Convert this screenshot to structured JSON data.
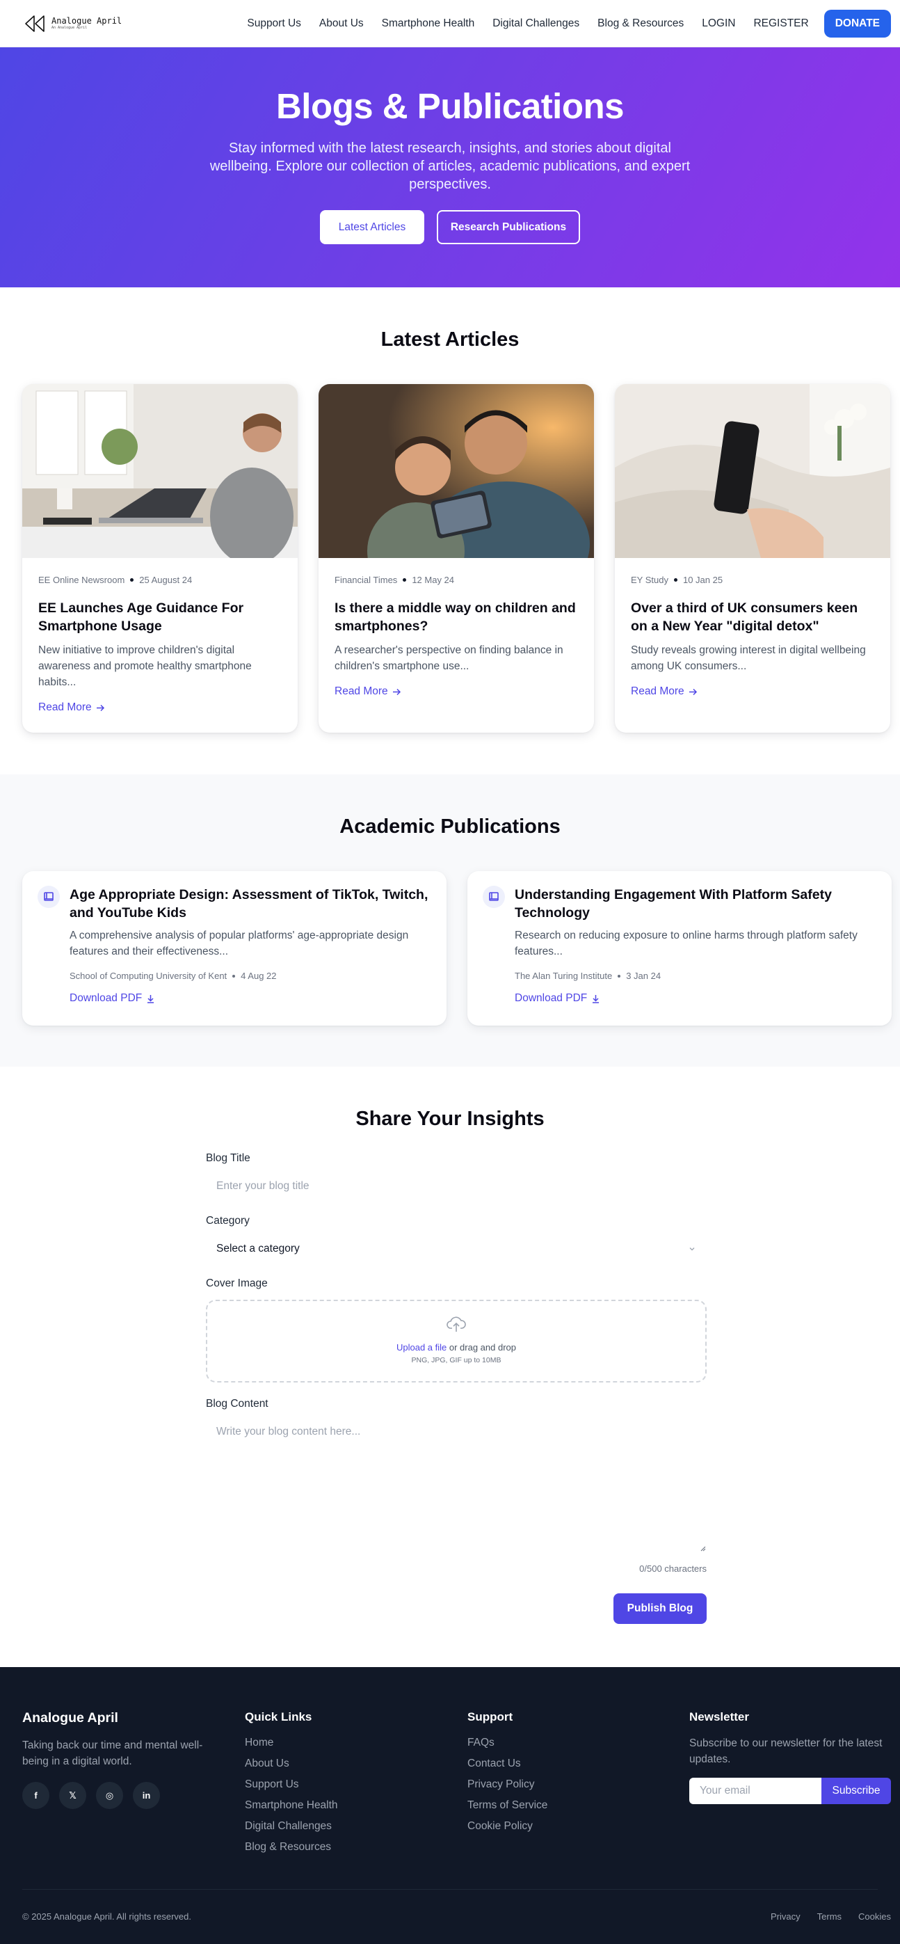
{
  "nav": {
    "brand_name": "Analogue April",
    "brand_tagline": "An Analogue April",
    "links": [
      "Support Us",
      "About Us",
      "Smartphone Health",
      "Digital Challenges",
      "Blog & Resources"
    ],
    "login": "LOGIN",
    "register": "REGISTER",
    "donate": "DONATE"
  },
  "hero": {
    "title": "Blogs & Publications",
    "subtitle": "Stay informed with the latest research, insights, and stories about digital wellbeing. Explore our collection of articles, academic publications, and expert perspectives.",
    "btn_latest": "Latest Articles",
    "btn_research": "Research Publications"
  },
  "articles": {
    "title": "Latest Articles",
    "read_more": "Read More",
    "items": [
      {
        "source": "EE Online Newsroom",
        "date": "25 August 24",
        "title": "EE Launches Age Guidance For Smartphone Usage",
        "desc": "New initiative to improve children's digital awareness and promote healthy smartphone habits..."
      },
      {
        "source": "Financial Times",
        "date": "12 May 24",
        "title": "Is there a middle way on children and smartphones?",
        "desc": "A researcher's perspective on finding balance in children's smartphone use..."
      },
      {
        "source": "EY Study",
        "date": "10 Jan 25",
        "title": "Over a third of UK consumers keen on a New Year \"digital detox\"",
        "desc": "Study reveals growing interest in digital wellbeing among UK consumers..."
      }
    ]
  },
  "publications": {
    "title": "Academic Publications",
    "download": "Download PDF",
    "items": [
      {
        "title": "Age Appropriate Design: Assessment of TikTok, Twitch, and YouTube Kids",
        "desc": "A comprehensive analysis of popular platforms' age-appropriate design features and their effectiveness...",
        "source": "School of Computing University of Kent",
        "date": "4 Aug 22"
      },
      {
        "title": "Understanding Engagement With Platform Safety Technology",
        "desc": "Research on reducing exposure to online harms through platform safety features...",
        "source": "The Alan Turing Institute",
        "date": "3 Jan 24"
      }
    ]
  },
  "form": {
    "title": "Share Your Insights",
    "blog_title_label": "Blog Title",
    "blog_title_placeholder": "Enter your blog title",
    "category_label": "Category",
    "category_value": "Select a category",
    "cover_label": "Cover Image",
    "upload_link": "Upload a file",
    "upload_rest": " or drag and drop",
    "upload_hint": "PNG, JPG, GIF up to 10MB",
    "content_label": "Blog Content",
    "content_placeholder": "Write your blog content here...",
    "counter": "0/500 characters",
    "publish": "Publish Blog"
  },
  "footer": {
    "brand": "Analogue April",
    "tagline": "Taking back our time and mental well-being in a digital world.",
    "socials": [
      "f",
      "𝕏",
      "◎",
      "in"
    ],
    "quick_title": "Quick Links",
    "quick_links": [
      "Home",
      "About Us",
      "Support Us",
      "Smartphone Health",
      "Digital Challenges",
      "Blog & Resources"
    ],
    "support_title": "Support",
    "support_links": [
      "FAQs",
      "Contact Us",
      "Privacy Policy",
      "Terms of Service",
      "Cookie Policy"
    ],
    "news_title": "Newsletter",
    "news_text": "Subscribe to our newsletter for the latest updates.",
    "news_placeholder": "Your email",
    "news_btn": "Subscribe",
    "copyright": "© 2025 Analogue April. All rights reserved.",
    "legal": [
      "Privacy",
      "Terms",
      "Cookies"
    ]
  },
  "colors": {
    "accent": "#4f46e5",
    "donate": "#2563eb",
    "footer_bg": "#111827",
    "hero_start": "#4f46e5",
    "hero_end": "#9333ea"
  }
}
